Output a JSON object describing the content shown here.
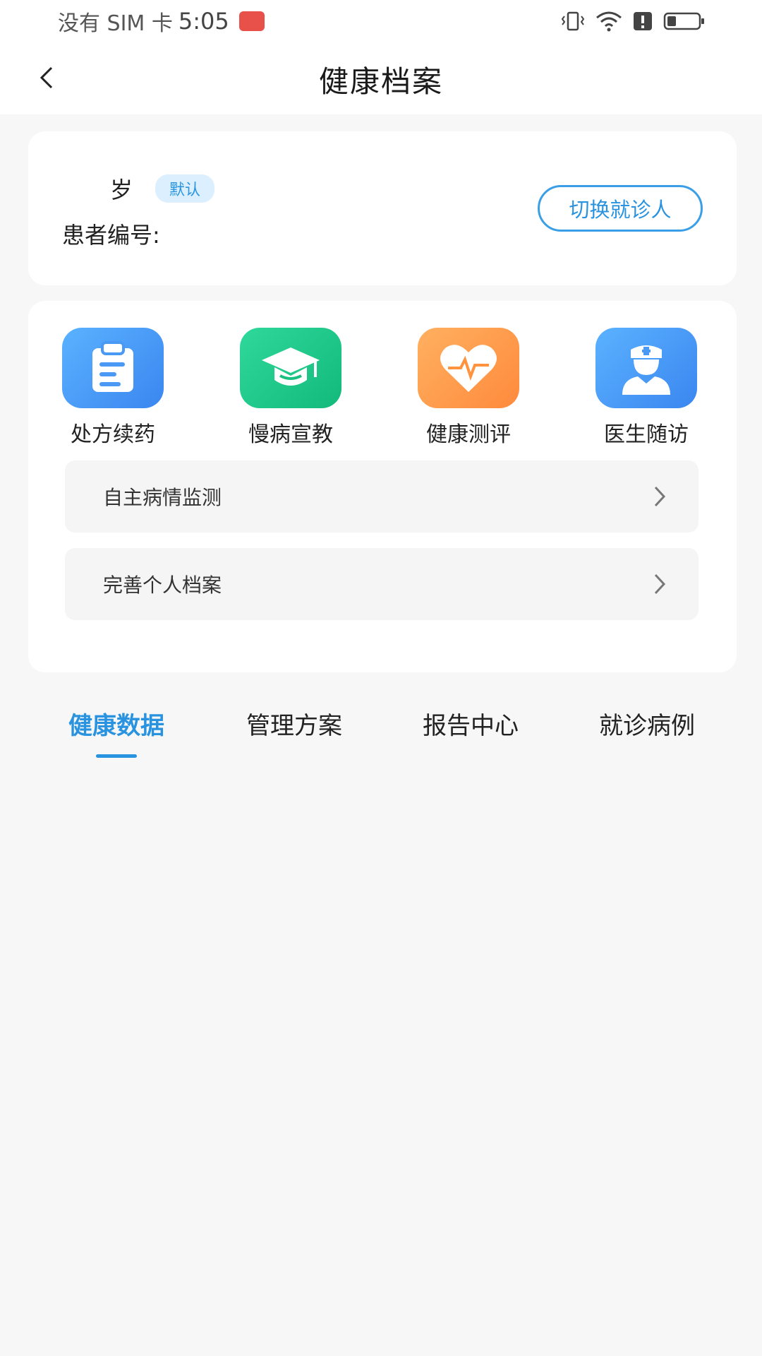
{
  "status_bar": {
    "carrier": "没有 SIM 卡",
    "time": "5:05"
  },
  "nav": {
    "title": "健康档案"
  },
  "patient": {
    "age_suffix": "岁",
    "default_badge": "默认",
    "id_label": "患者编号:",
    "switch_button": "切换就诊人"
  },
  "services": [
    {
      "label": "处方续药",
      "icon": "clipboard-icon",
      "color_from": "#5bb2ff",
      "color_to": "#3a86f0"
    },
    {
      "label": "慢病宣教",
      "icon": "graduation-cap-icon",
      "color_from": "#2fd99b",
      "color_to": "#12b97a"
    },
    {
      "label": "健康测评",
      "icon": "heart-pulse-icon",
      "color_from": "#ffb060",
      "color_to": "#ff8a3c"
    },
    {
      "label": "医生随访",
      "icon": "doctor-icon",
      "color_from": "#5bb2ff",
      "color_to": "#3a86f0"
    }
  ],
  "list_items": [
    {
      "label": "自主病情监测"
    },
    {
      "label": "完善个人档案"
    }
  ],
  "tabs": [
    {
      "label": "健康数据",
      "active": true
    },
    {
      "label": "管理方案",
      "active": false
    },
    {
      "label": "报告中心",
      "active": false
    },
    {
      "label": "就诊病例",
      "active": false
    }
  ],
  "colors": {
    "accent": "#2a93df",
    "background": "#f7f7f7"
  }
}
